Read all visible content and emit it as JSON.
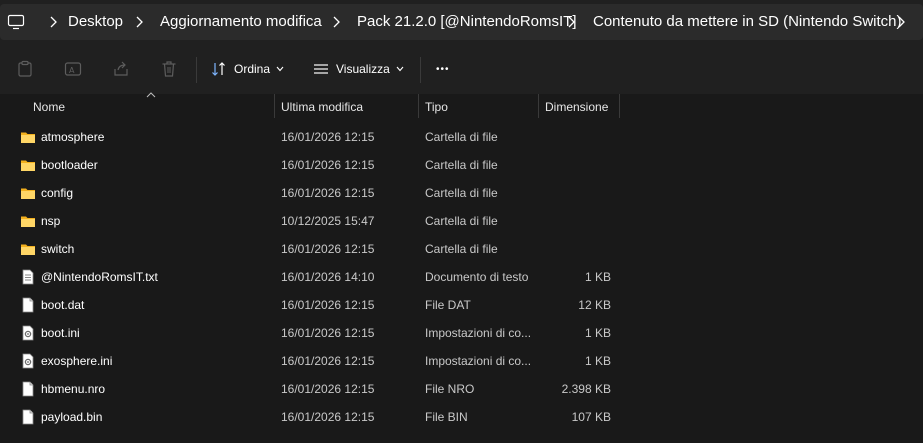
{
  "breadcrumb": [
    {
      "label": "Desktop"
    },
    {
      "label": "Aggiornamento modifica"
    },
    {
      "label": "Pack 21.2.0 [@NintendoRomsIT]"
    },
    {
      "label": "Contenuto da mettere in SD (Nintendo Switch)"
    }
  ],
  "toolbar": {
    "sort_label": "Ordina",
    "view_label": "Visualizza",
    "more_label": "•••"
  },
  "columns": {
    "name": "Nome",
    "modified": "Ultima modifica",
    "type": "Tipo",
    "size": "Dimensione"
  },
  "files": [
    {
      "name": "atmosphere",
      "modified": "16/01/2026 12:15",
      "type": "Cartella di file",
      "size": "",
      "icon": "folder-icon"
    },
    {
      "name": "bootloader",
      "modified": "16/01/2026 12:15",
      "type": "Cartella di file",
      "size": "",
      "icon": "folder-icon"
    },
    {
      "name": "config",
      "modified": "16/01/2026 12:15",
      "type": "Cartella di file",
      "size": "",
      "icon": "folder-icon"
    },
    {
      "name": "nsp",
      "modified": "10/12/2025 15:47",
      "type": "Cartella di file",
      "size": "",
      "icon": "folder-icon"
    },
    {
      "name": "switch",
      "modified": "16/01/2026 12:15",
      "type": "Cartella di file",
      "size": "",
      "icon": "folder-icon"
    },
    {
      "name": "@NintendoRomsIT.txt",
      "modified": "16/01/2026 14:10",
      "type": "Documento di testo",
      "size": "1 KB",
      "icon": "text-file-icon"
    },
    {
      "name": "boot.dat",
      "modified": "16/01/2026 12:15",
      "type": "File DAT",
      "size": "12 KB",
      "icon": "file-icon"
    },
    {
      "name": "boot.ini",
      "modified": "16/01/2026 12:15",
      "type": "Impostazioni di co...",
      "size": "1 KB",
      "icon": "settings-file-icon"
    },
    {
      "name": "exosphere.ini",
      "modified": "16/01/2026 12:15",
      "type": "Impostazioni di co...",
      "size": "1 KB",
      "icon": "settings-file-icon"
    },
    {
      "name": "hbmenu.nro",
      "modified": "16/01/2026 12:15",
      "type": "File NRO",
      "size": "2.398 KB",
      "icon": "file-icon"
    },
    {
      "name": "payload.bin",
      "modified": "16/01/2026 12:15",
      "type": "File BIN",
      "size": "107 KB",
      "icon": "file-icon"
    }
  ]
}
